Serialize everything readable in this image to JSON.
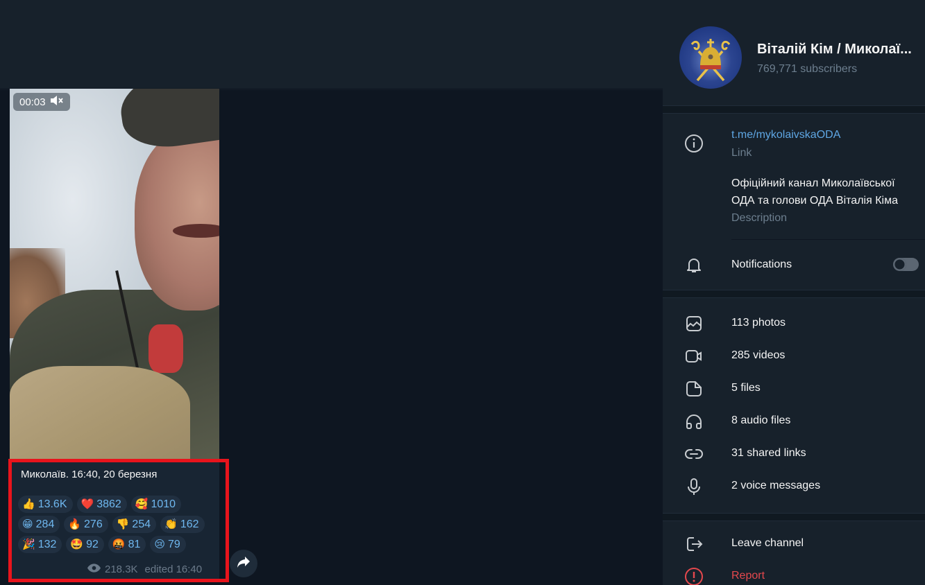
{
  "video": {
    "duration": "00:03",
    "muted_icon": "volume-muted-icon"
  },
  "message": {
    "caption": "Миколаїв. 16:40, 20 березня",
    "reactions": [
      {
        "emoji": "👍",
        "icon": "thumbs-up-icon",
        "count": "13.6K"
      },
      {
        "emoji": "❤️",
        "icon": "heart-icon",
        "count": "3862"
      },
      {
        "emoji": "🥰",
        "icon": "smiling-hearts-icon",
        "count": "1010"
      },
      {
        "emoji": "😁",
        "icon": "grin-icon",
        "count": "284"
      },
      {
        "emoji": "🔥",
        "icon": "fire-icon",
        "count": "276"
      },
      {
        "emoji": "👎",
        "icon": "thumbs-down-icon",
        "count": "254"
      },
      {
        "emoji": "👏",
        "icon": "clap-icon",
        "count": "162"
      },
      {
        "emoji": "🎉",
        "icon": "party-popper-icon",
        "count": "132"
      },
      {
        "emoji": "🤩",
        "icon": "star-struck-icon",
        "count": "92"
      },
      {
        "emoji": "🤬",
        "icon": "cursing-face-icon",
        "count": "81"
      },
      {
        "emoji": "😢",
        "icon": "crying-face-icon",
        "count": "79"
      }
    ],
    "views": "218.3K",
    "edited": "edited 16:40"
  },
  "channel": {
    "title": "Віталій Кім / Миколаї...",
    "subscribers": "769,771 subscribers",
    "link": "t.me/mykolaivskaODA",
    "link_label": "Link",
    "description_line1": "Офіційний канал Миколаївської",
    "description_line2": "ОДА та голови ОДА Віталія Кіма",
    "description_label": "Description",
    "notifications_label": "Notifications",
    "notifications_enabled": false
  },
  "media": [
    {
      "icon": "photo-icon",
      "label": "113 photos"
    },
    {
      "icon": "video-icon",
      "label": "285 videos"
    },
    {
      "icon": "file-icon",
      "label": "5 files"
    },
    {
      "icon": "headphones-icon",
      "label": "8 audio files"
    },
    {
      "icon": "link-icon",
      "label": "31 shared links"
    },
    {
      "icon": "microphone-icon",
      "label": "2 voice messages"
    }
  ],
  "actions": {
    "leave": "Leave channel",
    "report": "Report"
  },
  "colors": {
    "accent": "#5fa7e4",
    "danger": "#e5484d",
    "highlight": "#e8141c"
  }
}
